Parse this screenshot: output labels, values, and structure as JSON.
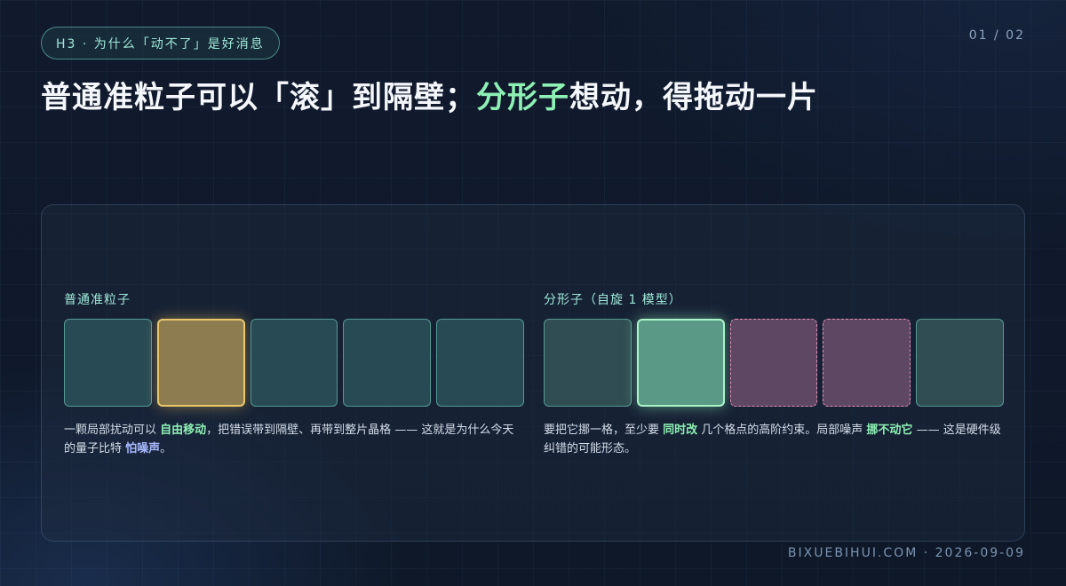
{
  "tag": "H3 · 为什么「动不了」是好消息",
  "page_number": "01 / 02",
  "title": {
    "part1": "普通准粒子可以「滚」到隔壁；",
    "highlight": "分形子",
    "part2": "想动，得拖动一片"
  },
  "left_panel": {
    "title": "普通准粒子",
    "desc": {
      "t1": "一颗局部扰动可以 ",
      "b1": "自由移动",
      "t2": "，把错误带到隔壁、再带到整片晶格 —— 这就是为什么今天的量子比特 ",
      "b2": "怕噪声",
      "t3": "。"
    }
  },
  "right_panel": {
    "title": "分形子（自旋 1 模型）",
    "desc": {
      "t1": "要把它挪一格，至少要 ",
      "b1": "同时改",
      "t2": " 几个格点的高阶约束。局部噪声 ",
      "b2": "挪不动它",
      "t3": " —— 这是硬件级纠错的可能形态。"
    }
  },
  "footer": "BIXUEBIHUI.COM · 2026-09-09",
  "colors": {
    "accent_green": "#8ef0b4",
    "accent_teal": "#9fe8d8",
    "gold": "#e9c76a",
    "pink": "#e58fb4",
    "blue": "#a8b8ff"
  }
}
